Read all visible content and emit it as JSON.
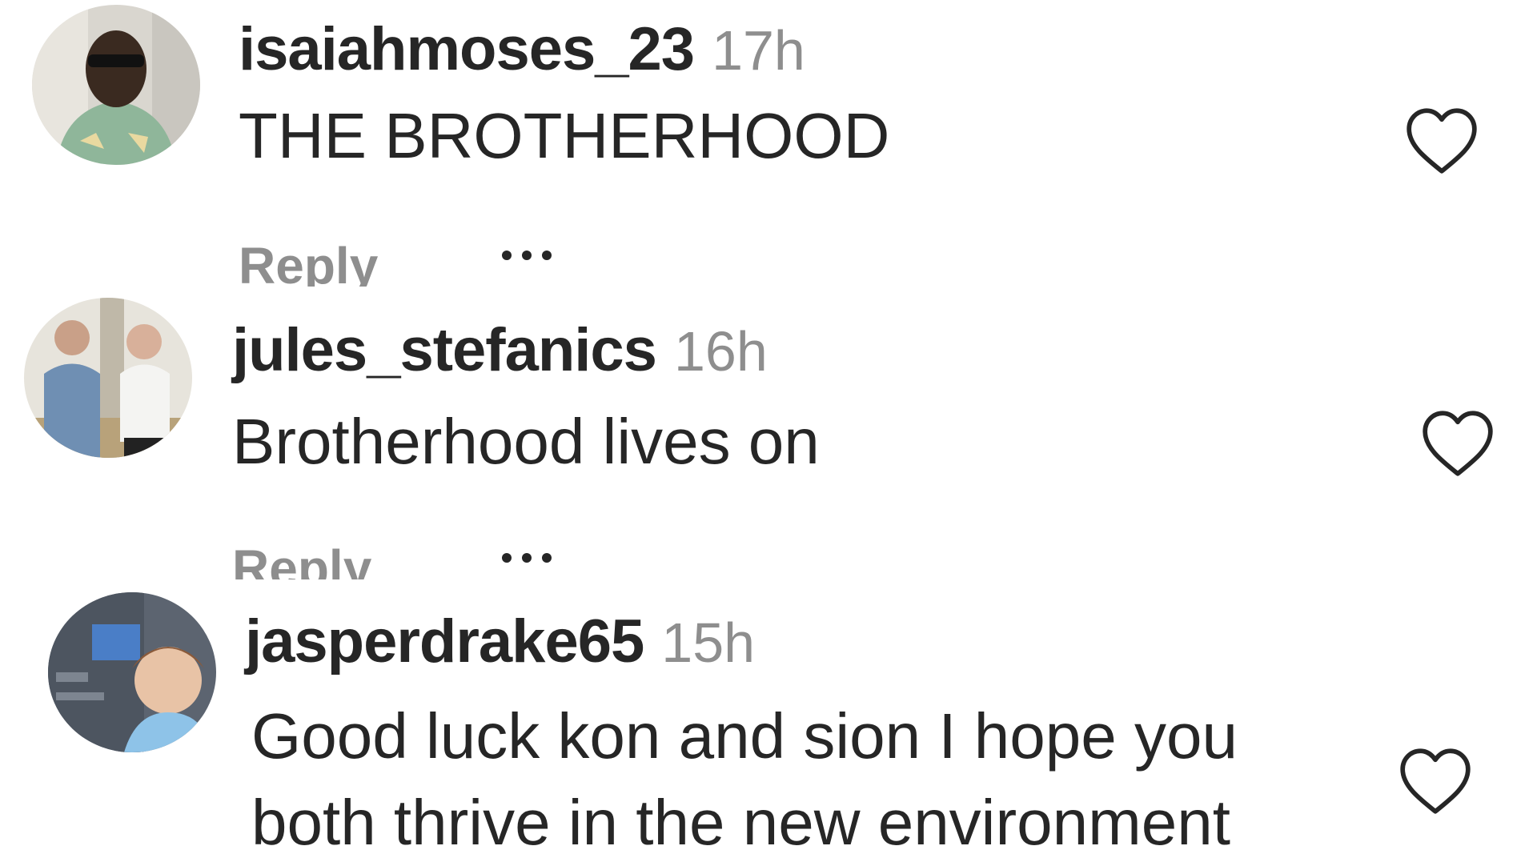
{
  "comments": [
    {
      "username": "isaiahmoses_23",
      "time": "17h",
      "text_lines": [
        "THE BROTHERHOOD"
      ],
      "reply_label": "Reply",
      "avatar_icon": "user-avatar-photo",
      "like_icon": "heart-outline-icon",
      "more_icon": "more-options-icon"
    },
    {
      "username": "jules_stefanics",
      "time": "16h",
      "text_lines": [
        "Brotherhood lives on"
      ],
      "reply_label": "Reply",
      "avatar_icon": "user-avatar-photo",
      "like_icon": "heart-outline-icon",
      "more_icon": "more-options-icon"
    },
    {
      "username": "jasperdrake65",
      "time": "15h",
      "text_lines": [
        "Good luck kon and sion I hope you",
        "both thrive in the new environment"
      ],
      "avatar_icon": "user-avatar-photo",
      "like_icon": "heart-outline-icon"
    }
  ],
  "colors": {
    "text": "#262626",
    "muted": "#8e8e8e",
    "background": "#ffffff"
  }
}
